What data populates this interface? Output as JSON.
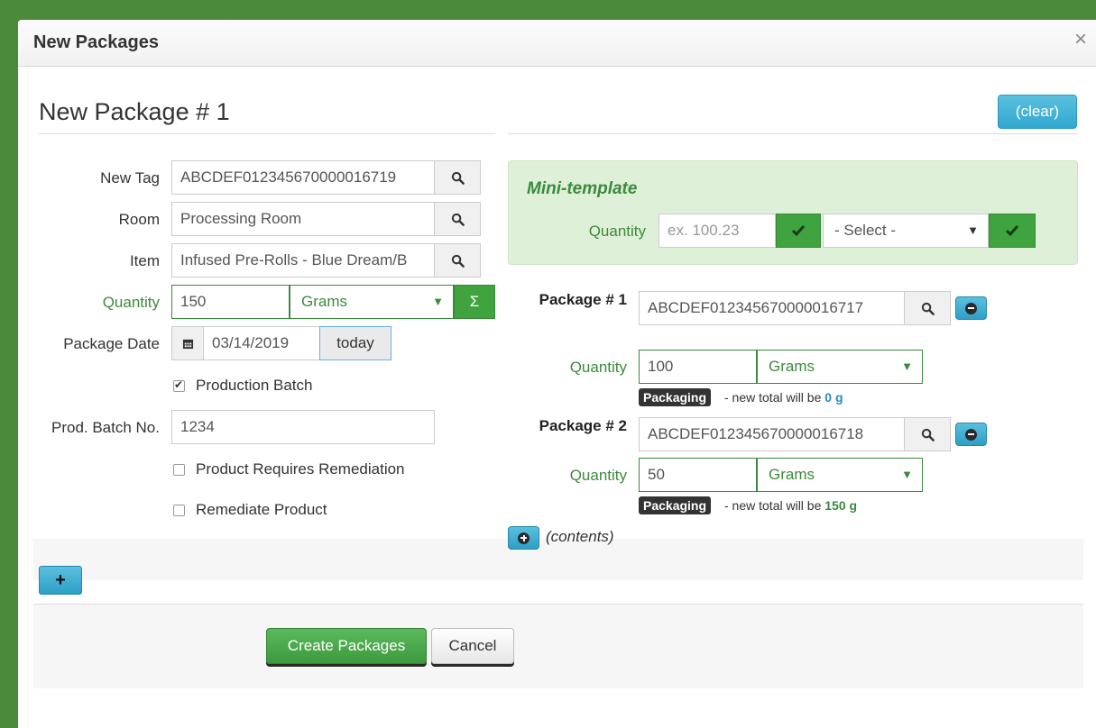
{
  "modal": {
    "title": "New Packages",
    "close": "×"
  },
  "package": {
    "title": "New Package # 1",
    "clear_label": "(clear)",
    "new_tag": {
      "label": "New Tag",
      "value": "ABCDEF012345670000016719"
    },
    "room": {
      "label": "Room",
      "value": "Processing Room"
    },
    "item": {
      "label": "Item",
      "value": "Infused Pre-Rolls - Blue Dream/B"
    },
    "quantity": {
      "label": "Quantity",
      "value": "150",
      "unit": "Grams",
      "sum_symbol": "Σ"
    },
    "package_date": {
      "label": "Package Date",
      "value": "03/14/2019",
      "today_label": "today"
    },
    "production_batch": {
      "label": "Production Batch",
      "checked": true
    },
    "prod_batch_no": {
      "label": "Prod. Batch No.",
      "value": "1234"
    },
    "requires_remediation": {
      "label": "Product Requires Remediation",
      "checked": false
    },
    "remediate_product": {
      "label": "Remediate Product",
      "checked": false
    }
  },
  "mini_template": {
    "title": "Mini-template",
    "quantity_label": "Quantity",
    "quantity_placeholder": "ex. 100.23",
    "select_value": "- Select -"
  },
  "sources": [
    {
      "label": "Package # 1",
      "tag": "ABCDEF012345670000016717",
      "quantity_label": "Quantity",
      "quantity": "100",
      "unit": "Grams",
      "badge": "Packaging",
      "note_prefix": "- new total will be",
      "note_total": "0 g"
    },
    {
      "label": "Package # 2",
      "tag": "ABCDEF012345670000016718",
      "quantity_label": "Quantity",
      "quantity": "50",
      "unit": "Grams",
      "badge": "Packaging",
      "note_prefix": "- new total will be",
      "note_total": "150 g"
    }
  ],
  "contents_label": "(contents)",
  "add_package_label": "+",
  "footer": {
    "create_label": "Create Packages",
    "cancel_label": "Cancel"
  },
  "icons": {
    "search": "search-icon",
    "check": "check-icon",
    "calendar": "calendar-icon",
    "minus": "minus-circle-icon",
    "plus": "plus-circle-icon"
  },
  "colors": {
    "accent_green": "#3c8a3c",
    "info_blue": "#5bc0de",
    "success_green": "#5cb85c"
  }
}
